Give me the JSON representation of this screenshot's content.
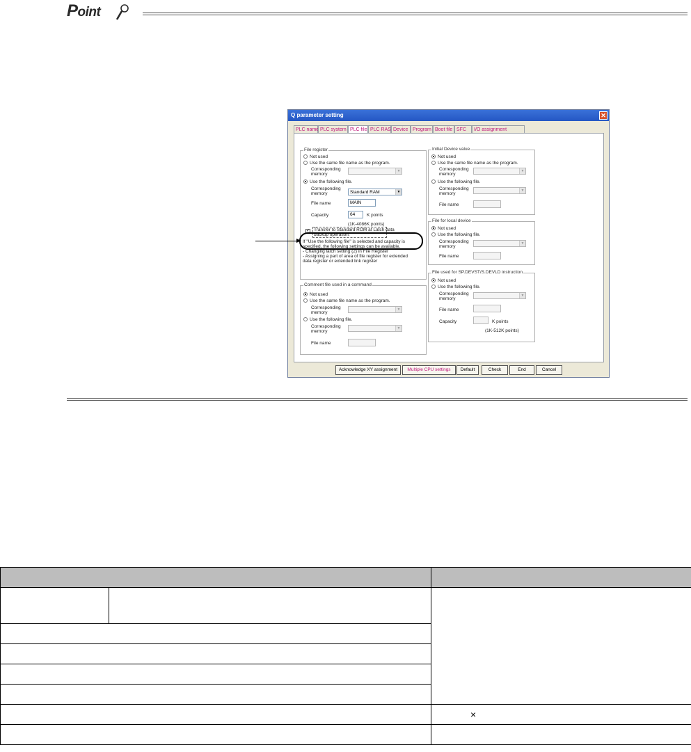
{
  "point": {
    "logo_p": "P",
    "logo_rest": "oint"
  },
  "dialog": {
    "title": "Q parameter setting",
    "close": "✕",
    "tabs": [
      "PLC name",
      "PLC system",
      "PLC file",
      "PLC RAS",
      "Device",
      "Program",
      "Boot file",
      "SFC",
      "I/O assignment"
    ],
    "active_tab": "PLC file",
    "file_register": {
      "title": "File register",
      "opt_not_used": "Not used",
      "opt_same_name": "Use the same file name as the program.",
      "corr_mem_1": "Corresponding",
      "corr_mem_2": "memory",
      "opt_following": "Use the following file.",
      "corr_mem_value": "Standard RAM",
      "file_name_label": "File name",
      "file_name_value": "MAIN",
      "capacity_label": "Capacity",
      "capacity_value": "64",
      "capacity_unit": "K points",
      "capacity_range": "(1K-4086K points)",
      "transfer_1": "Transfer to Standard ROM at Latch data",
      "transfer_2": "backup operation.",
      "note_1": "If \"Use the following file\" is selected and capacity is",
      "note_2": "specified, the following settings can be available.",
      "note_3": "- Changing latch setting (2) in File Register",
      "note_4": "- Assigning a part of area of file register for extended",
      "note_5": "data register or extended link register"
    },
    "comment_file": {
      "title": "Comment file used in a command",
      "opt_not_used": "Not used",
      "opt_same_name": "Use the same file name as the program.",
      "corr_mem_1": "Corresponding",
      "corr_mem_2": "memory",
      "opt_following": "Use the following file.",
      "file_name_label": "File name"
    },
    "initial_device": {
      "title": "Initial Device value",
      "opt_not_used": "Not used",
      "opt_same_name": "Use the same file name as the program.",
      "corr_mem_1": "Corresponding",
      "corr_mem_2": "memory",
      "opt_following": "Use the following file.",
      "file_name_label": "File name"
    },
    "local_device": {
      "title": "File for local device",
      "opt_not_used": "Not used",
      "opt_following": "Use the following file.",
      "corr_mem_1": "Corresponding",
      "corr_mem_2": "memory",
      "file_name_label": "File name"
    },
    "sp_devst": {
      "title": "File used for SP.DEVST/S.DEVLD instruction",
      "opt_not_used": "Not used",
      "opt_following": "Use the following file.",
      "corr_mem_1": "Corresponding",
      "corr_mem_2": "memory",
      "file_name_label": "File name",
      "capacity_label": "Capacity",
      "capacity_unit": "K points",
      "capacity_range": "(1K-512K points)"
    },
    "buttons": {
      "ack_xy": "Acknowledge XY assignment",
      "multi_cpu": "Multiple CPU settings",
      "default": "Default",
      "check": "Check",
      "end": "End",
      "cancel": "Cancel"
    }
  },
  "table": {
    "mark_x": "×"
  }
}
